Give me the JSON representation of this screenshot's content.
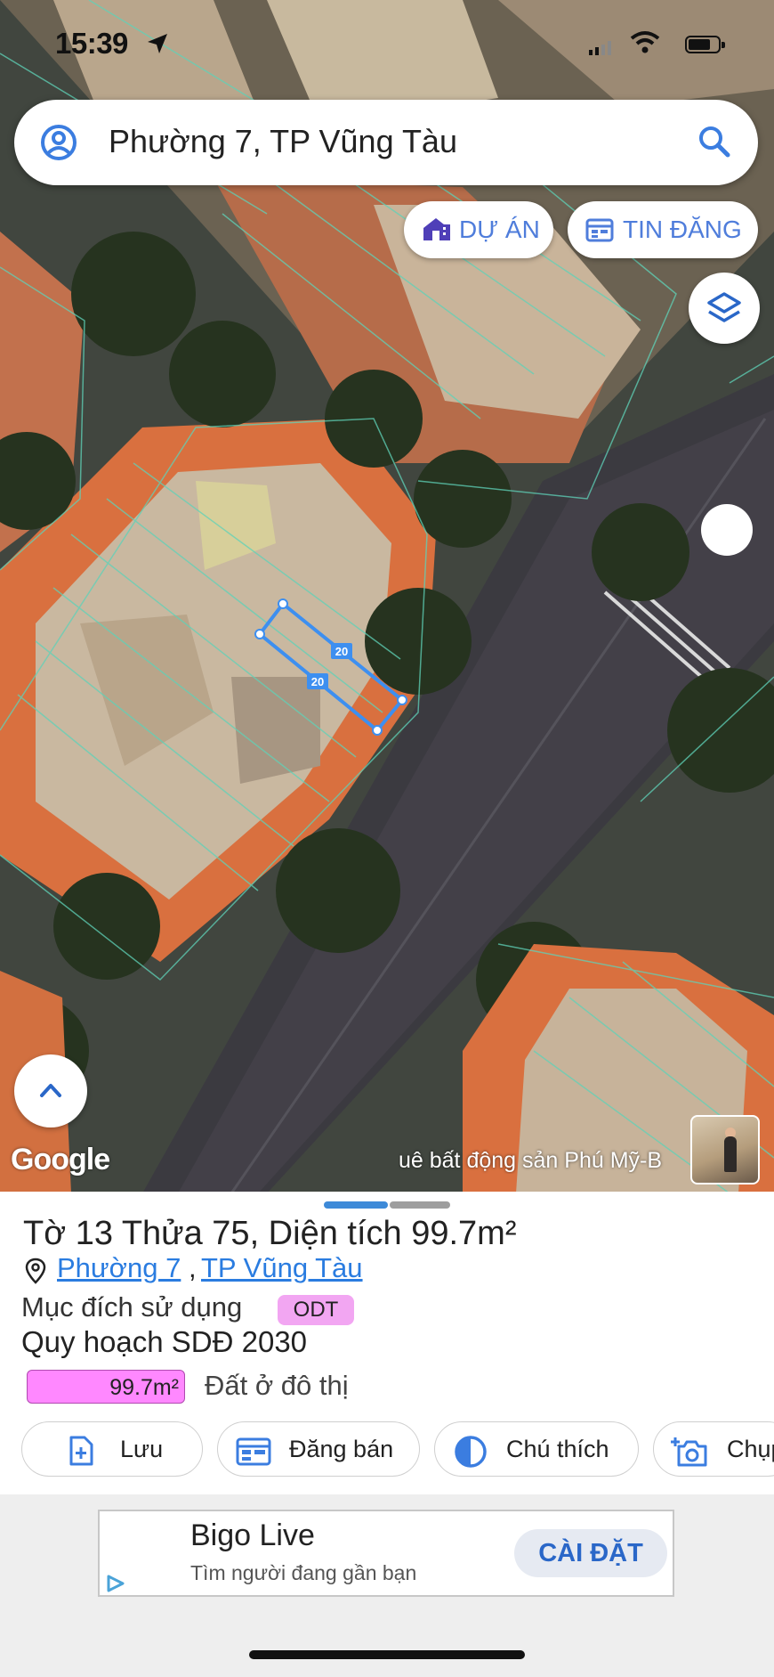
{
  "status_bar": {
    "time": "15:39"
  },
  "search": {
    "query": "Phường 7, TP Vũng Tàu"
  },
  "chips": {
    "du_an": "DỰ ÁN",
    "tin_dang": "TIN ĐĂNG"
  },
  "map": {
    "parcel_edge_labels": [
      "20",
      "20"
    ],
    "logo": "Google",
    "attribution": "uê bất động sản Phú Mỹ-B"
  },
  "parcel": {
    "title": "Tờ 13 Thửa 75, Diện tích 99.7m²",
    "ward_link": "Phường 7",
    "separator": ",",
    "city_link": "TP Vũng Tàu",
    "purpose_label": "Mục đích sử dụng",
    "purpose_code": "ODT",
    "planning_label": "Quy hoạch SDĐ 2030",
    "planning_area": "99.7m²",
    "planning_area_fraction": 1.0,
    "land_type": "Đất ở đô thị"
  },
  "actions": {
    "save": "Lưu",
    "post": "Đăng bán",
    "legend": "Chú thích",
    "capture": "Chụp"
  },
  "ad": {
    "name": "Bigo Live",
    "subtitle": "Tìm người đang gần bạn",
    "cta": "CÀI ĐẶT"
  },
  "colors": {
    "accent_blue": "#4f7ddb",
    "link_blue": "#2a7ce0",
    "parcel_outline": "#3d8ff0",
    "odt_badge": "#f2a6f2",
    "planning_bar": "#ff88ff"
  }
}
